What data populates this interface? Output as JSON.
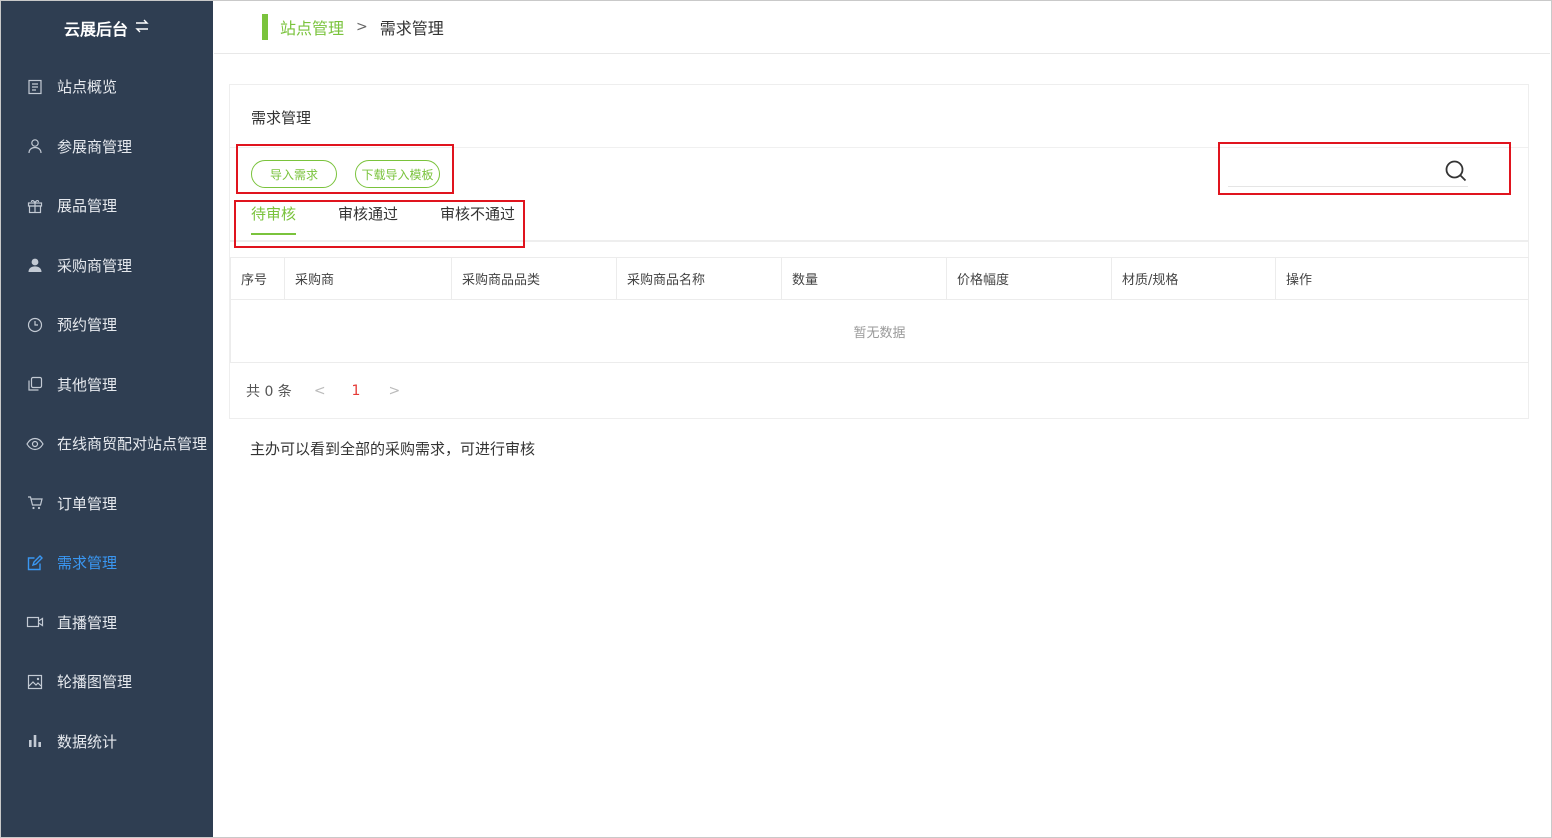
{
  "sidebar": {
    "brand": "云展后台",
    "items": [
      {
        "label": "站点概览",
        "icon": "document-icon"
      },
      {
        "label": "参展商管理",
        "icon": "user-icon"
      },
      {
        "label": "展品管理",
        "icon": "gift-icon"
      },
      {
        "label": "采购商管理",
        "icon": "person-filled-icon"
      },
      {
        "label": "预约管理",
        "icon": "clock-icon"
      },
      {
        "label": "其他管理",
        "icon": "copy-icon"
      },
      {
        "label": "在线商贸配对站点管理",
        "icon": "eye-icon"
      },
      {
        "label": "订单管理",
        "icon": "cart-icon"
      },
      {
        "label": "需求管理",
        "icon": "edit-icon",
        "active": true
      },
      {
        "label": "直播管理",
        "icon": "video-icon"
      },
      {
        "label": "轮播图管理",
        "icon": "image-icon"
      },
      {
        "label": "数据统计",
        "icon": "bar-chart-icon"
      }
    ]
  },
  "header": {
    "breadcrumb_root": "站点管理",
    "breadcrumb_sep": ">",
    "breadcrumb_current": "需求管理"
  },
  "card": {
    "title": "需求管理",
    "import_button": "导入需求",
    "download_template_button": "下载导入模板",
    "search_placeholder": "",
    "tabs": [
      "待审核",
      "审核通过",
      "审核不通过"
    ],
    "active_tab": 0,
    "table": {
      "columns": [
        "序号",
        "采购商",
        "采购商品品类",
        "采购商品名称",
        "数量",
        "价格幅度",
        "材质/规格",
        "操作"
      ],
      "empty_text": "暂无数据"
    },
    "pagination": {
      "total_text": "共 0 条",
      "prev": "<",
      "current_page": "1",
      "next": ">"
    }
  },
  "note": "主办可以看到全部的采购需求，可进行审核",
  "colors": {
    "sidebar_bg": "#2f3e52",
    "accent_green": "#7ac33c",
    "active_blue": "#3a97f2",
    "highlight_red": "#e0141e"
  }
}
